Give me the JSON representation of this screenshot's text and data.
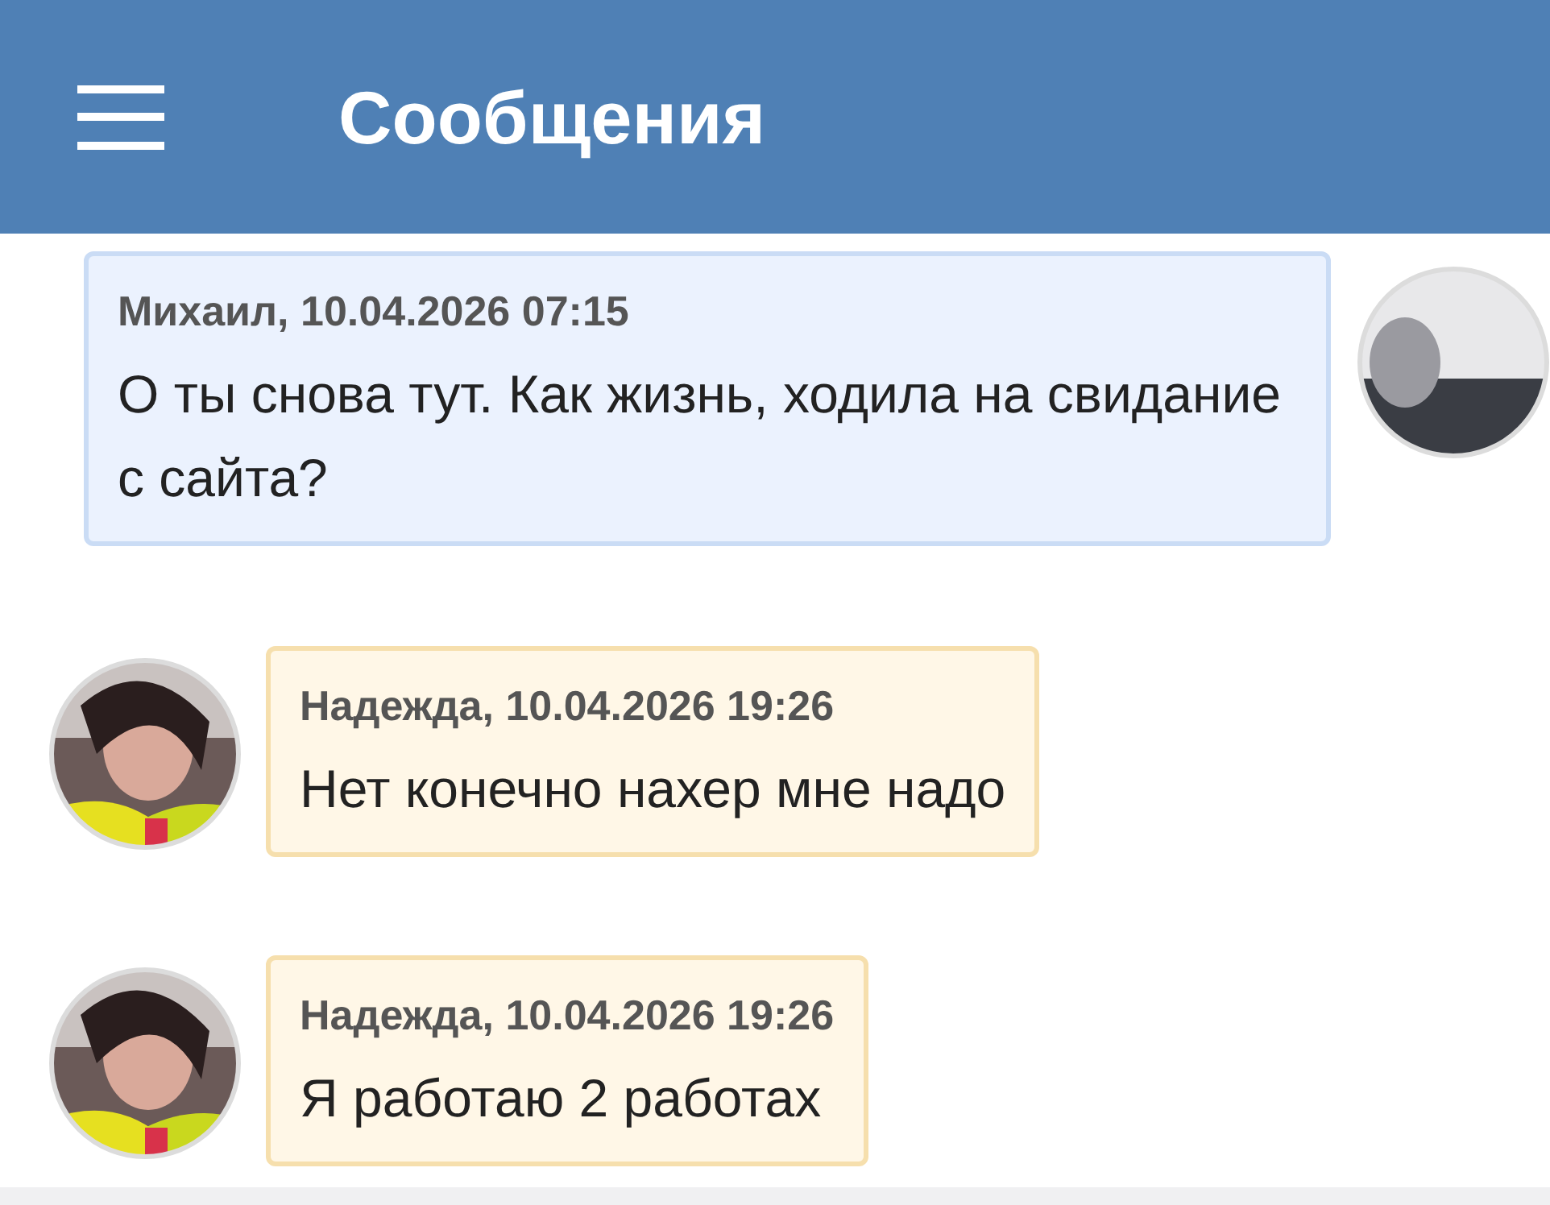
{
  "header": {
    "title": "Сообщения"
  },
  "messages": [
    {
      "kind": "outgoing",
      "meta": "Михаил, 10.04.2026 07:15",
      "text": "О ты снова тут. Как жизнь, ходила на свидание с сайта?"
    },
    {
      "kind": "incoming",
      "meta": "Надежда, 10.04.2026 19:26",
      "text": "Нет конечно нахер мне надо"
    },
    {
      "kind": "incoming",
      "meta": "Надежда, 10.04.2026 19:26",
      "text": "Я работаю 2 работах"
    }
  ]
}
